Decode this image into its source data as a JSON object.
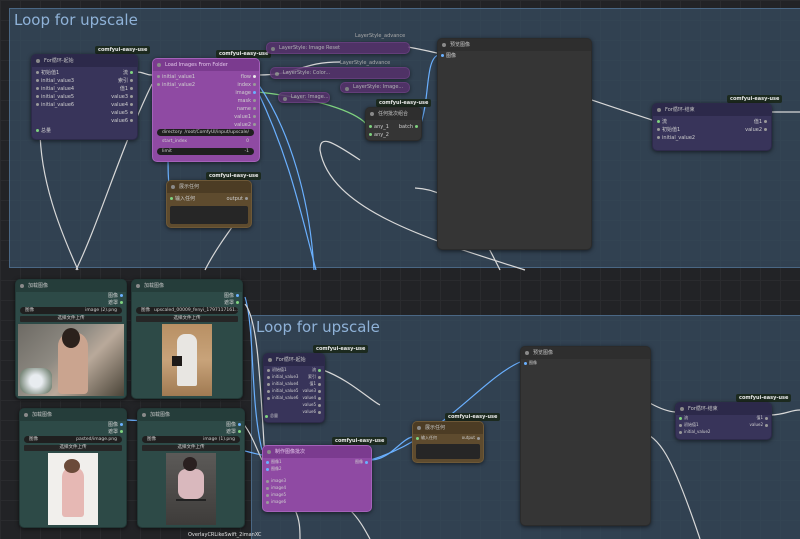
{
  "colors": {
    "group": "#384e62",
    "purple": "#8f4aa3",
    "navy": "#38345a",
    "teal": "#2d4a47",
    "brown": "#5e4b2e",
    "wire_blue": "#6ab0ff",
    "wire_white": "#d8d8d8",
    "wire_green": "#7fd27f"
  },
  "groups": [
    {
      "title": "Loop for upscale"
    },
    {
      "title": "Loop for upscale"
    }
  ],
  "badge": "comfyui-easy-use",
  "top": {
    "for_start": {
      "title": "For循环-起始",
      "inputs": [
        "初始值1",
        "initial_value3",
        "initial_value4",
        "initial_value5",
        "initial_value6"
      ],
      "outputs": [
        "流",
        "索引",
        "值1",
        "value3",
        "value4",
        "value5",
        "value6"
      ],
      "extra": "总量"
    },
    "load_folder": {
      "title": "Load Images From Folder",
      "inputs": [
        "initial_value1",
        "initial_value2"
      ],
      "outputs": [
        "flow",
        "index",
        "image",
        "mask",
        "name",
        "value1",
        "value2"
      ],
      "w1_label": "directory",
      "w1_value": "/root/ComfyUI/input/upscale/",
      "w2_label": "start_index",
      "w2_value": "0",
      "w3_label": "limit",
      "w3_value": "-1"
    },
    "show_any": {
      "title": "展示任何",
      "in": "输入任何",
      "out": "output"
    },
    "layerstyle1": {
      "title": "LayerStyle: Image Reset"
    },
    "layerstyle2": {
      "title": "LayerStyle: Color..."
    },
    "layerstyle3": {
      "title": "LayerStyle: Image..."
    },
    "layer_small": {
      "title": "Layer: Image..."
    },
    "layerstyle_label": "LayerStyle_advance",
    "batch": {
      "title": "任何批次组合",
      "inputs": [
        "any_1",
        "any_2"
      ],
      "out": "batch"
    },
    "preview": {
      "title": "预览图像",
      "in": "图像"
    },
    "for_end": {
      "title": "For循环-结束",
      "inputs": [
        "流",
        "初始值1",
        "initial_value2"
      ],
      "outputs": [
        "值1",
        "value2"
      ]
    }
  },
  "loaders": [
    {
      "title": "加载图像",
      "outputs": [
        "图像",
        "遮罩"
      ],
      "file_label": "图像",
      "file_value": "image (2).png",
      "upload": "选择文件上传"
    },
    {
      "title": "加载图像",
      "outputs": [
        "图像",
        "遮罩"
      ],
      "file_label": "图像",
      "file_value": "upscaled_00009_fenyi_1797117161...",
      "upload": "选择文件上传"
    },
    {
      "title": "加载图像",
      "outputs": [
        "图像",
        "遮罩"
      ],
      "file_label": "图像",
      "file_value": "pasted/image.png",
      "upload": "选择文件上传"
    },
    {
      "title": "加载图像",
      "outputs": [
        "图像",
        "遮罩"
      ],
      "file_label": "图像",
      "file_value": "image (1).png",
      "upload": "选择文件上传"
    }
  ],
  "bottom": {
    "for_start": {
      "title": "For循环-起始",
      "inputs": [
        "初始值1",
        "initial_value3",
        "initial_value4",
        "initial_value5",
        "initial_value6"
      ],
      "outputs": [
        "流",
        "索引",
        "值1",
        "value3",
        "value4",
        "value5",
        "value6"
      ],
      "extra": "总量"
    },
    "batch_images": {
      "title": "制作图像批次",
      "inputs": [
        "图像1",
        "图像2",
        "image3",
        "image4",
        "image5",
        "image6"
      ],
      "out": "图像"
    },
    "show_any": {
      "title": "展示任何",
      "in": "输入任何",
      "out": "output"
    },
    "preview": {
      "title": "预览图像",
      "in": "图像"
    },
    "for_end": {
      "title": "For循环-结束",
      "inputs": [
        "流",
        "初始值1",
        "initial_value2"
      ],
      "outputs": [
        "值1",
        "value2"
      ]
    },
    "footer_text": "OverlayCRLikeSwift_2imanXC"
  }
}
